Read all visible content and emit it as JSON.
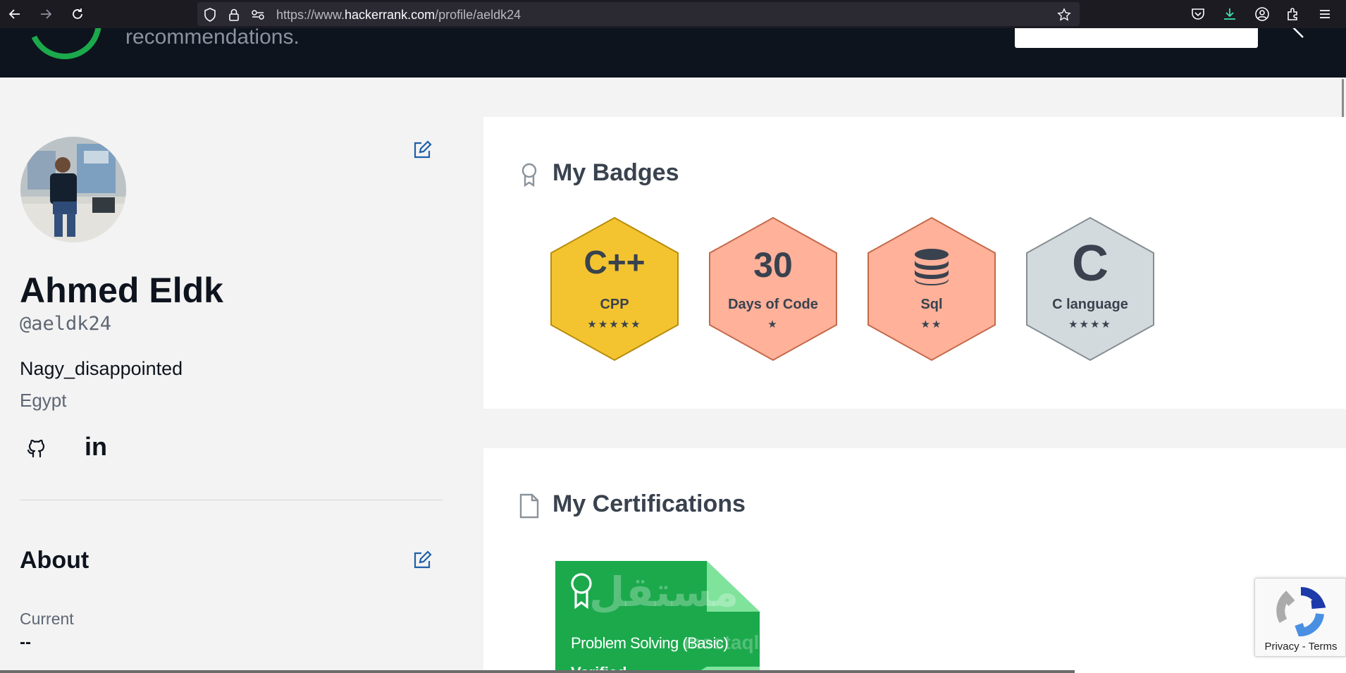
{
  "browser": {
    "url_prefix": "https://www.",
    "url_domain": "hackerrank.com",
    "url_path": "/profile/aeldk24"
  },
  "header": {
    "tagline": "recommendations."
  },
  "profile": {
    "name": "Ahmed Eldk",
    "username": "@aeldk24",
    "bio": "Nagy_disappointed",
    "country": "Egypt",
    "social": [
      "github-icon",
      "linkedin-icon"
    ],
    "linkedin_text": "in"
  },
  "about": {
    "title": "About",
    "current_label": "Current",
    "current_value": "--"
  },
  "badges": {
    "title": "My Badges",
    "items": [
      {
        "label": "CPP",
        "glyph": "C++",
        "stars": 5,
        "stars_text": "★★★★★",
        "color": "gold"
      },
      {
        "label": "Days of Code",
        "glyph": "30",
        "stars": 1,
        "stars_text": "★",
        "color": "bronze"
      },
      {
        "label": "Sql",
        "glyph": "database-icon",
        "stars": 2,
        "stars_text": "★★",
        "color": "bronze"
      },
      {
        "label": "C language",
        "glyph": "C",
        "stars": 4,
        "stars_text": "★★★★",
        "color": "silver"
      }
    ]
  },
  "certifications": {
    "title": "My Certifications",
    "items": [
      {
        "title": "Problem Solving (Basic)",
        "status": "Verified"
      }
    ]
  },
  "watermark": {
    "arabic": "مستقل",
    "latin": "mostaql.com"
  },
  "recaptcha": {
    "privacy": "Privacy",
    "separator": " - ",
    "terms": "Terms"
  },
  "colors": {
    "header_bg": "#0e141e",
    "accent_green": "#1ba94c",
    "gold": "#f5c22b",
    "bronze": "#ffa98d",
    "silver": "#cfd8dc"
  }
}
